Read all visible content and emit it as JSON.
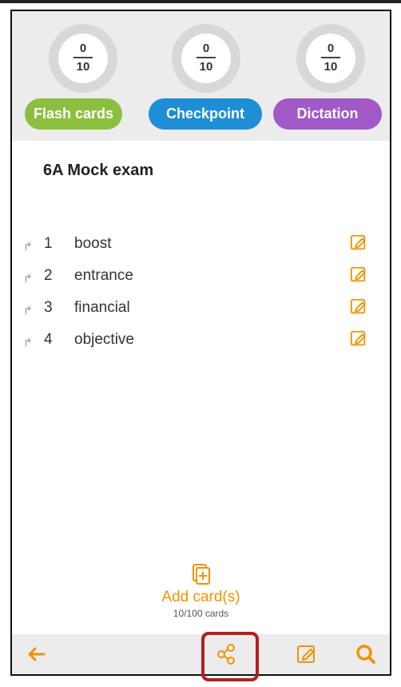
{
  "stats": [
    {
      "num": "0",
      "den": "10"
    },
    {
      "num": "0",
      "den": "10"
    },
    {
      "num": "0",
      "den": "10"
    }
  ],
  "modes": [
    {
      "label": "Flash cards",
      "color": "#8cbf3f"
    },
    {
      "label": "Checkpoint",
      "color": "#1e8ed6"
    },
    {
      "label": "Dictation",
      "color": "#a059c6"
    }
  ],
  "deck": {
    "title": "6A Mock exam"
  },
  "cards": [
    {
      "index": "1",
      "word": "boost"
    },
    {
      "index": "2",
      "word": "entrance"
    },
    {
      "index": "3",
      "word": "financial"
    },
    {
      "index": "4",
      "word": "objective"
    }
  ],
  "add_cards": {
    "label": "Add card(s)",
    "count": "10/100 cards"
  },
  "accent_color": "#f39200",
  "highlight_color": "#b21f1f",
  "footer_icons": [
    "back-arrow-icon",
    "share-icon",
    "edit-icon",
    "search-icon"
  ]
}
